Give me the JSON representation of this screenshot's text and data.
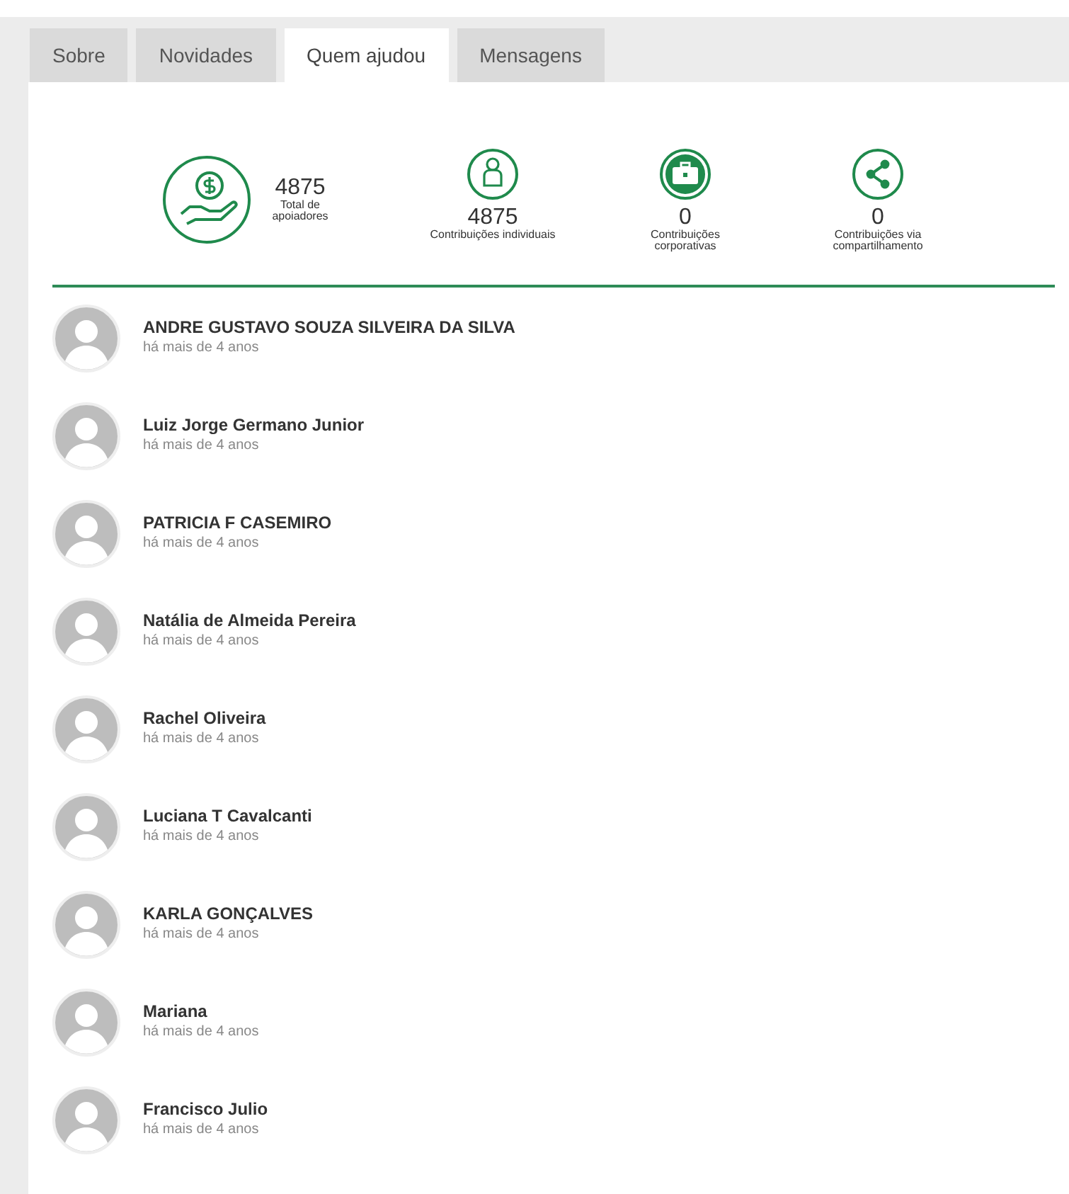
{
  "tabs": [
    {
      "label": "Sobre",
      "selected": false
    },
    {
      "label": "Novidades",
      "selected": false
    },
    {
      "label": "Quem ajudou",
      "selected": true
    },
    {
      "label": "Mensagens",
      "selected": false
    }
  ],
  "stats": [
    {
      "kind": "main",
      "value": "4875",
      "label": "Total de apoiadores"
    },
    {
      "kind": "small",
      "value": "4875",
      "label": "Contribuições individuais"
    },
    {
      "kind": "small",
      "value": "0",
      "label": "Contribuições corporativas"
    },
    {
      "kind": "small",
      "value": "0",
      "label": "Contribuições via compartilhamento"
    }
  ],
  "supporters": [
    {
      "name": "ANDRE GUSTAVO SOUZA SILVEIRA DA SILVA",
      "time": "há mais de 4 anos"
    },
    {
      "name": "Luiz Jorge Germano Junior",
      "time": "há mais de 4 anos"
    },
    {
      "name": "PATRICIA F CASEMIRO",
      "time": "há mais de 4 anos"
    },
    {
      "name": "Natália de Almeida Pereira",
      "time": "há mais de 4 anos"
    },
    {
      "name": "Rachel Oliveira",
      "time": "há mais de 4 anos"
    },
    {
      "name": "Luciana T Cavalcanti",
      "time": "há mais de 4 anos"
    },
    {
      "name": "KARLA GONÇALVES",
      "time": "há mais de 4 anos"
    },
    {
      "name": "Mariana",
      "time": "há mais de 4 anos"
    },
    {
      "name": "Francisco Julio",
      "time": "há mais de 4 anos"
    }
  ]
}
